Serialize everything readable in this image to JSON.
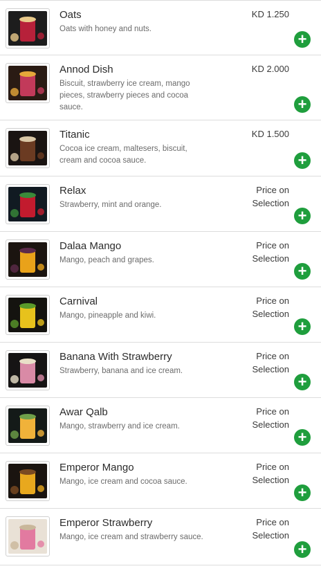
{
  "accent_color": "#1f9e3d",
  "add_icon": "plus-icon",
  "items": [
    {
      "name": "Oats",
      "description": "Oats with honey and nuts.",
      "price_lines": [
        "KD 1.250"
      ],
      "thumb_colors": [
        "#1d1d1d",
        "#b7213a",
        "#e8c98a"
      ]
    },
    {
      "name": "Annod Dish",
      "description": "Biscuit, strawberry ice cream, mango pieces, strawberry pieces and cocoa sauce.",
      "price_lines": [
        "KD 2.000"
      ],
      "thumb_colors": [
        "#2a1b14",
        "#c23a5a",
        "#e6a83a"
      ]
    },
    {
      "name": "Titanic",
      "description": "Cocoa ice cream, maltesers, biscuit, cream and cocoa sauce.",
      "price_lines": [
        "KD 1.500"
      ],
      "thumb_colors": [
        "#1a1412",
        "#6b3b22",
        "#d9c6a5"
      ]
    },
    {
      "name": "Relax",
      "description": "Strawberry, mint and orange.",
      "price_lines": [
        "Price on",
        "Selection"
      ],
      "thumb_colors": [
        "#111a22",
        "#c21b2e",
        "#3a8a3a"
      ]
    },
    {
      "name": "Dalaa Mango",
      "description": "Mango, peach and grapes.",
      "price_lines": [
        "Price on",
        "Selection"
      ],
      "thumb_colors": [
        "#1b1410",
        "#e9a21a",
        "#5c2a4a"
      ]
    },
    {
      "name": "Carnival",
      "description": "Mango, pineapple and kiwi.",
      "price_lines": [
        "Price on",
        "Selection"
      ],
      "thumb_colors": [
        "#14130f",
        "#e7c21c",
        "#5a9a2a"
      ]
    },
    {
      "name": "Banana With Strawberry",
      "description": "Strawberry, banana and ice cream.",
      "price_lines": [
        "Price on",
        "Selection"
      ],
      "thumb_colors": [
        "#161414",
        "#d98aa6",
        "#e9e0c8"
      ]
    },
    {
      "name": "Awar Qalb",
      "description": "Mango, strawberry and ice cream.",
      "price_lines": [
        "Price on",
        "Selection"
      ],
      "thumb_colors": [
        "#141a18",
        "#f0b23a",
        "#6fa04a"
      ]
    },
    {
      "name": "Emperor Mango",
      "description": "Mango, ice cream and cocoa sauce.",
      "price_lines": [
        "Price on",
        "Selection"
      ],
      "thumb_colors": [
        "#1a1410",
        "#e8a81e",
        "#7a4a22"
      ]
    },
    {
      "name": "Emperor Strawberry",
      "description": "Mango, ice cream and strawberry sauce.",
      "price_lines": [
        "Price on",
        "Selection"
      ],
      "thumb_colors": [
        "#e9e1d6",
        "#e27aa0",
        "#c9b79a"
      ]
    }
  ]
}
